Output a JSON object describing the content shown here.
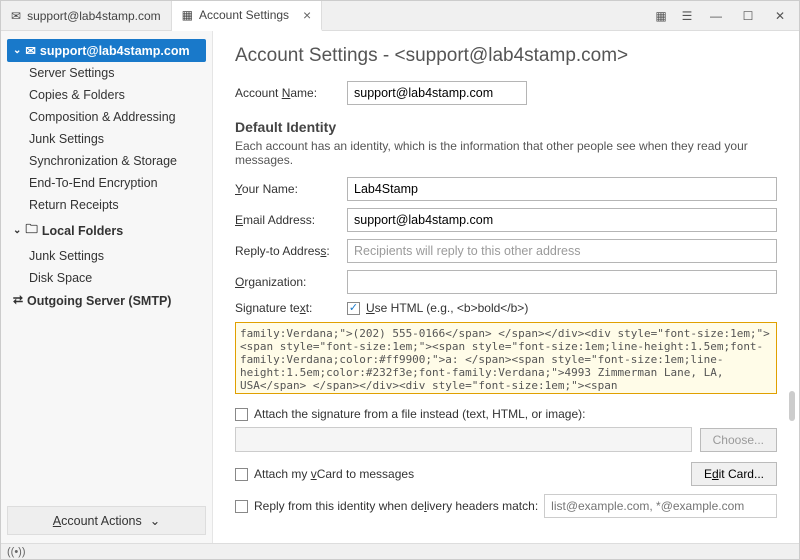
{
  "tabs": {
    "mail": "support@lab4stamp.com",
    "settings": "Account Settings"
  },
  "sidebar": {
    "account": "support@lab4stamp.com",
    "items": [
      "Server Settings",
      "Copies & Folders",
      "Composition & Addressing",
      "Junk Settings",
      "Synchronization & Storage",
      "End-To-End Encryption",
      "Return Receipts"
    ],
    "localFolders": "Local Folders",
    "localItems": [
      "Junk Settings",
      "Disk Space"
    ],
    "outgoing": "Outgoing Server (SMTP)",
    "accountActions": "Account Actions"
  },
  "header": {
    "title": "Account Settings - <support@lab4stamp.com>"
  },
  "fields": {
    "accountNameLabel": "Account Name:",
    "accountNameValue": "support@lab4stamp.com",
    "defaultIdentity": "Default Identity",
    "identityDesc": "Each account has an identity, which is the information that other people see when they read your messages.",
    "yourNameLabel": "Your Name:",
    "yourNameValue": "Lab4Stamp",
    "emailLabel": "Email Address:",
    "emailValue": "support@lab4stamp.com",
    "replyLabel": "Reply-to Address:",
    "replyPlaceholder": "Recipients will reply to this other address",
    "orgLabel": "Organization:",
    "sigLabel": "Signature text:",
    "useHtml": "Use HTML (e.g., <b>bold</b>)",
    "signatureText": "family:Verdana;\">(202) 555-0166</span> </span></div><div style=\"font-size:1em;\"><span style=\"font-size:1em;\"><span style=\"font-size:1em;line-height:1.5em;font-family:Verdana;color:#ff9900;\">a: </span><span style=\"font-size:1em;line-height:1.5em;color:#232f3e;font-family:Verdana;\">4993 Zimmerman Lane, LA, USA</span> </span></div><div style=\"font-size:1em;\"><span",
    "attachFile": "Attach the signature from a file instead (text, HTML, or image):",
    "choose": "Choose...",
    "attachVcard": "Attach my vCard to messages",
    "editCard": "Edit Card...",
    "replyIdentity": "Reply from this identity when delivery headers match:",
    "replyPlaceholder2": "list@example.com, *@example.com"
  }
}
